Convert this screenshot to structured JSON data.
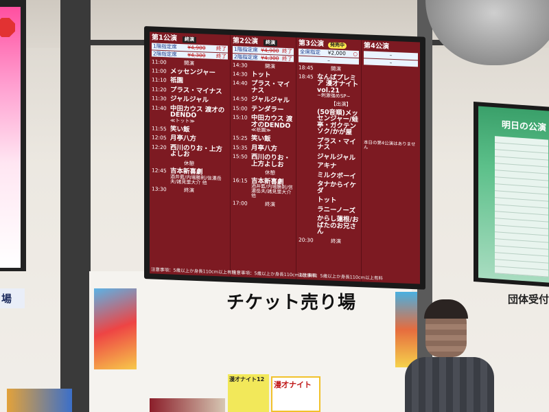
{
  "main_board": {
    "columns": [
      {
        "title": "第1公演",
        "status": "終演",
        "tickets": [
          {
            "label": "1階指定席",
            "price": "¥4,900",
            "status": "終了"
          },
          {
            "label": "2階指定席",
            "price": "¥4,300",
            "status": "終了"
          }
        ],
        "rows": [
          {
            "time": "11:00",
            "act": "開演",
            "break": true
          },
          {
            "time": "11:00",
            "act": "メッセンジャー"
          },
          {
            "time": "11:10",
            "act": "祇園"
          },
          {
            "time": "11:20",
            "act": "プラス・マイナス"
          },
          {
            "time": "11:30",
            "act": "ジャルジャル"
          },
          {
            "time": "11:40",
            "act": "中田カウス 渡才のDENDO",
            "sub": "≪トット≫"
          },
          {
            "time": "11:55",
            "act": "笑い飯"
          },
          {
            "time": "12:05",
            "act": "月亭八方"
          },
          {
            "time": "12:20",
            "act": "西川のりお・上方よしお"
          },
          {
            "time": "",
            "act": "休憩",
            "break": true
          },
          {
            "time": "12:45",
            "act": "吉本新喜劇",
            "sub": "酒井藍/内場勝則/信濃岳夫/諸見里大介 他"
          },
          {
            "time": "13:30",
            "act": "終演",
            "break": true
          }
        ],
        "note": "注意事項：5歳以上か身長110cm以上有料"
      },
      {
        "title": "第2公演",
        "status": "終演",
        "tickets": [
          {
            "label": "1階指定席",
            "price": "¥4,900",
            "status": "終了"
          },
          {
            "label": "2階指定席",
            "price": "¥4,300",
            "status": "終了"
          }
        ],
        "rows": [
          {
            "time": "14:30",
            "act": "開演",
            "break": true
          },
          {
            "time": "14:30",
            "act": "トット"
          },
          {
            "time": "14:40",
            "act": "プラス・マイナス"
          },
          {
            "time": "14:50",
            "act": "ジャルジャル"
          },
          {
            "time": "15:00",
            "act": "テンダラー"
          },
          {
            "time": "15:10",
            "act": "中田カウス 渡才のDENDO",
            "sub": "≪祇園≫"
          },
          {
            "time": "15:25",
            "act": "笑い飯"
          },
          {
            "time": "15:35",
            "act": "月亭八方"
          },
          {
            "time": "15:50",
            "act": "西川のりお・上方よしお"
          },
          {
            "time": "",
            "act": "休憩",
            "break": true
          },
          {
            "time": "16:15",
            "act": "吉本新喜劇",
            "sub": "酒井藍/内場勝則/信濃岳夫/諸見里大介 他"
          },
          {
            "time": "17:00",
            "act": "終演",
            "break": true
          }
        ],
        "note": "注意事項：5歳以上か身長110cm以上有料"
      },
      {
        "title": "第3公演",
        "status": "発売中",
        "tickets": [
          {
            "label": "全席指定",
            "price": "¥2,000",
            "status": "○"
          },
          {
            "label": "",
            "price": "–",
            "status": ""
          }
        ],
        "rows": [
          {
            "time": "18:45",
            "act": "開演",
            "break": true
          },
          {
            "time": "18:45",
            "act": "なんばプレミア 漫才ナイトvol.21",
            "sub": "~刺激強めSP~"
          },
          {
            "time": "",
            "act": "【出演】",
            "break": true
          },
          {
            "time": "",
            "act": "(50音順)メッセンジャー/蛙亭・ガクテンソク/かが屋"
          },
          {
            "time": "",
            "act": "プラス・マイナス"
          },
          {
            "time": "",
            "act": "ジャルジャル"
          },
          {
            "time": "",
            "act": "アキナ"
          },
          {
            "time": "",
            "act": "ミルクボーイ"
          },
          {
            "time": "",
            "act": "タナからイケダ"
          },
          {
            "time": "",
            "act": "トット"
          },
          {
            "time": "",
            "act": "ラニーノーズ"
          },
          {
            "time": "",
            "act": "からし蓮根/おばたのお兄さん"
          },
          {
            "time": "20:30",
            "act": "終演",
            "break": true
          }
        ],
        "note": "注意事項：5歳以上か身長110cm以上有料"
      },
      {
        "title": "第4公演",
        "status": "",
        "tickets": [
          {
            "label": "",
            "price": "–",
            "status": ""
          },
          {
            "label": "",
            "price": "–",
            "status": ""
          }
        ],
        "rows": [],
        "no_show": "本日の第4公演はありません"
      }
    ]
  },
  "right_board": {
    "title": "明日の公演"
  },
  "signs": {
    "ticket_office": "チケット売り場",
    "group_reception": "団体受付",
    "left_partial": "場"
  },
  "posters": [
    {
      "text": "漫才ナイト"
    },
    {
      "text": "漫才ナイト12"
    }
  ]
}
